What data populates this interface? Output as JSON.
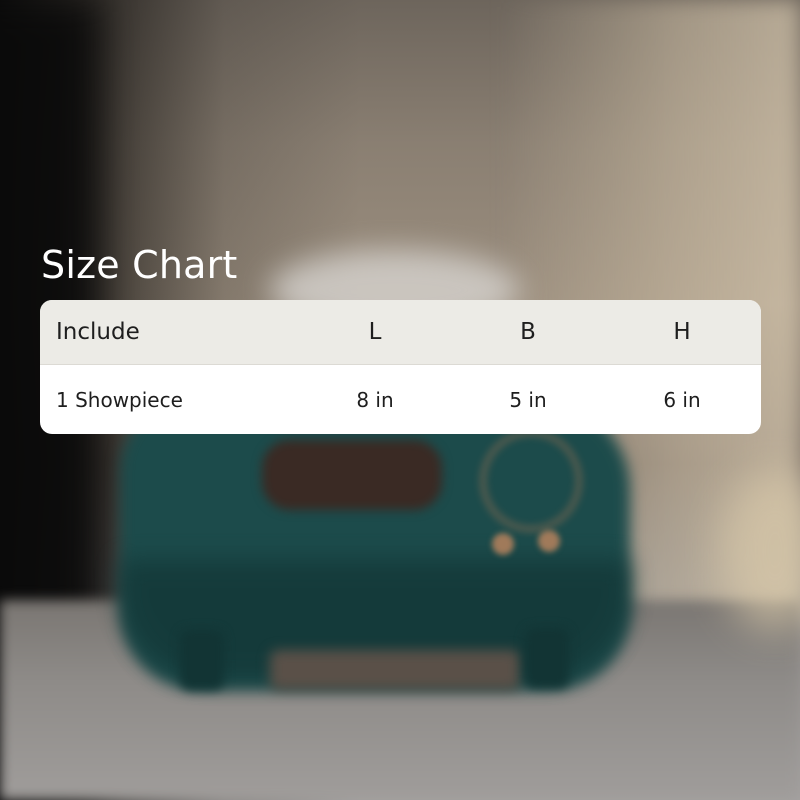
{
  "title": "Size Chart",
  "table": {
    "headers": [
      "Include",
      "L",
      "B",
      "H"
    ],
    "rows": [
      [
        "1 Showpiece",
        "8 in",
        "5 in",
        "6 in"
      ]
    ]
  },
  "colors": {
    "header_bg": "#ecebe6",
    "row_bg": "#ffffff",
    "title_text": "#ffffff",
    "product_color": "#1c4b4b"
  }
}
